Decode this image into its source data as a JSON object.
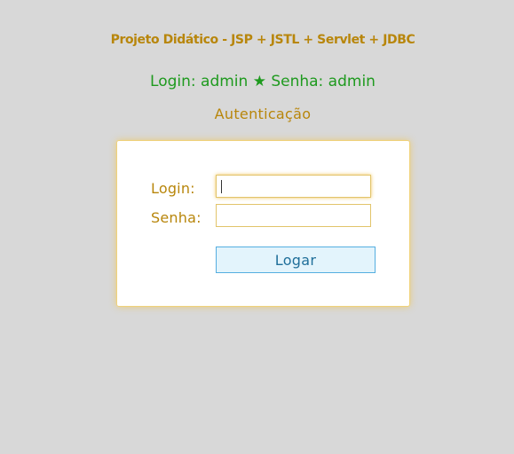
{
  "header": {
    "project_title": "Projeto Didático - JSP + JSTL + Servlet + JDBC",
    "credentials_hint": "Login: admin ★ Senha: admin",
    "section_title": "Autenticação"
  },
  "form": {
    "login_label": "Login:",
    "login_value": "",
    "senha_label": "Senha:",
    "senha_value": "",
    "submit_label": "Logar"
  },
  "colors": {
    "background": "#d8d8d8",
    "accent": "#b8860b",
    "hint": "#1e9a1e",
    "button_border": "#55aee0",
    "button_bg": "#e3f4fc"
  }
}
